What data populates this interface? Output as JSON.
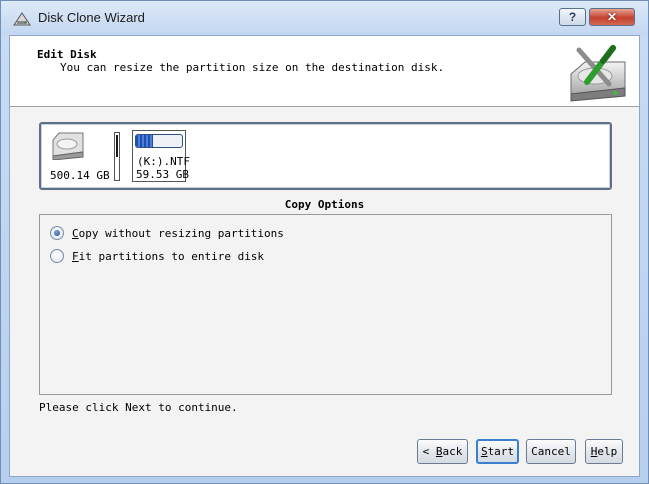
{
  "window": {
    "title": "Disk Clone Wizard",
    "help_label": "?",
    "close_label": "✕",
    "app_icon": "disk-clone-app-icon"
  },
  "header": {
    "title": "Edit Disk",
    "description": "You can resize the partition size on the destination disk.",
    "graphic_icon": "disk-tools-icon"
  },
  "disk": {
    "size": "500.14 GB",
    "icon": "hard-disk-icon",
    "partition": {
      "label": "(K:).NTF",
      "size": "59.53 GB",
      "used_fraction": 0.38
    }
  },
  "options": {
    "title": "Copy Options",
    "items": [
      {
        "accesskey": "C",
        "rest": "opy without resizing partitions",
        "checked": true
      },
      {
        "accesskey": "F",
        "rest": "it partitions to entire disk",
        "checked": false
      }
    ]
  },
  "status": "Please click Next to continue.",
  "buttons": {
    "back_arrow": "<",
    "back_accesskey": "B",
    "back_rest": "ack",
    "start_accesskey": "S",
    "start_rest": "tart",
    "cancel_label": "Cancel",
    "help_accesskey": "H",
    "help_rest": "elp"
  },
  "colors": {
    "title_gradient": "#c3d7f1",
    "partition_fill": "#1e4fb0",
    "close_red": "#c54030",
    "default_button_border": "#3c7fd0"
  }
}
